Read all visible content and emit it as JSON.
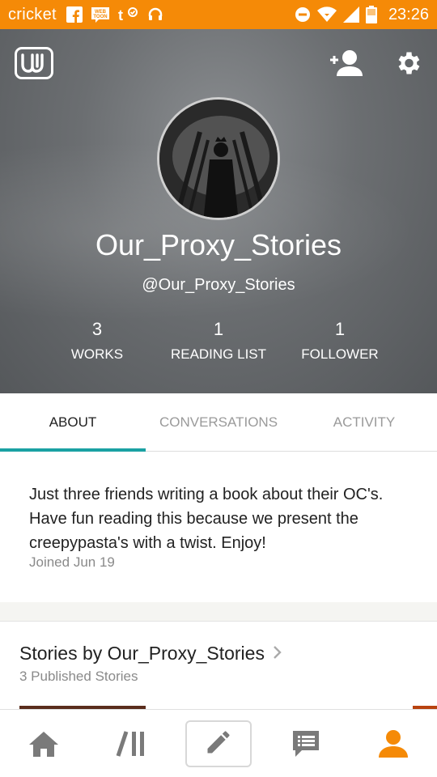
{
  "status_bar": {
    "carrier": "cricket",
    "time": "23:26",
    "left_icons": [
      "facebook-icon",
      "webtoon-icon",
      "tumblr-check-icon",
      "headset-icon"
    ],
    "right_icons": [
      "do-not-disturb-icon",
      "wifi-icon",
      "signal-icon",
      "battery-icon"
    ],
    "webtoon_text": "WEB TOON"
  },
  "header": {
    "username": "Our_Proxy_Stories",
    "handle": "@Our_Proxy_Stories",
    "stats": [
      {
        "value": "3",
        "label": "WORKS"
      },
      {
        "value": "1",
        "label": "READING LIST"
      },
      {
        "value": "1",
        "label": "FOLLOWER"
      }
    ]
  },
  "tabs": [
    {
      "label": "ABOUT",
      "active": true
    },
    {
      "label": "CONVERSATIONS",
      "active": false
    },
    {
      "label": "ACTIVITY",
      "active": false
    }
  ],
  "about": {
    "description": "Just three friends writing a book about their OC's. Have fun reading this because we present the creepypasta's with a twist. Enjoy!",
    "joined": "Joined Jun 19"
  },
  "stories": {
    "title": "Stories by Our_Proxy_Stories",
    "subtitle": "3 Published Stories"
  },
  "bottom_nav": [
    "home-icon",
    "library-icon",
    "write-icon",
    "messages-icon",
    "profile-icon"
  ],
  "colors": {
    "status_bar": "#f58a07",
    "accent_teal": "#1aa1a3",
    "active_nav": "#f58a07",
    "inactive_nav": "#7a7a7a"
  }
}
